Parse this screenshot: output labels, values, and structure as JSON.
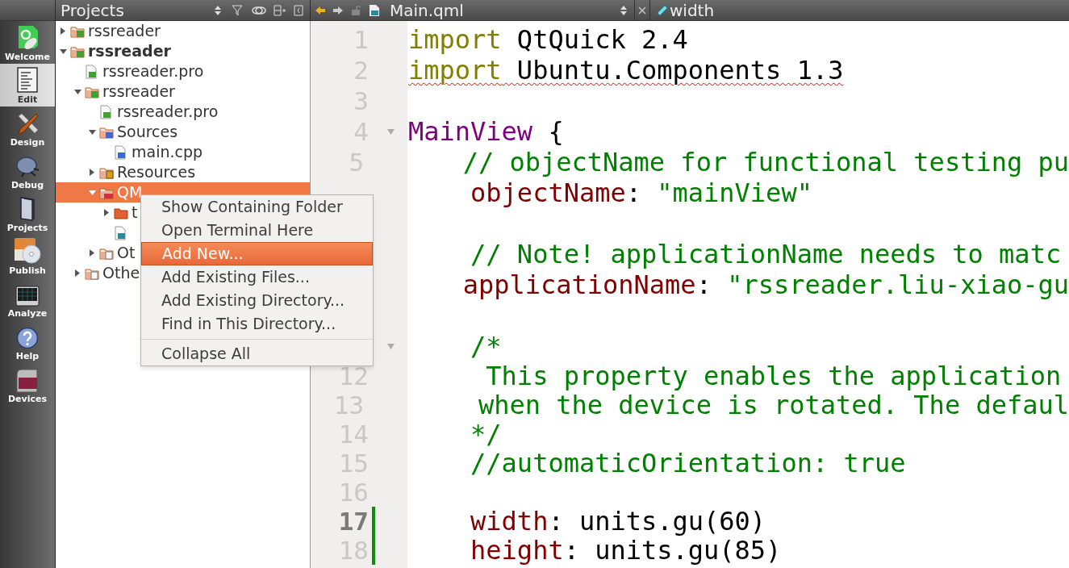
{
  "modes": [
    {
      "kind": "welcome",
      "label": "Welcome",
      "selected": false
    },
    {
      "kind": "edit",
      "label": "Edit",
      "selected": true
    },
    {
      "kind": "design",
      "label": "Design",
      "selected": false
    },
    {
      "kind": "debug",
      "label": "Debug",
      "selected": false
    },
    {
      "kind": "projects",
      "label": "Projects",
      "selected": false
    },
    {
      "kind": "publish",
      "label": "Publish",
      "selected": false
    },
    {
      "kind": "analyze",
      "label": "Analyze",
      "selected": false
    },
    {
      "kind": "help",
      "label": "Help",
      "selected": false
    },
    {
      "kind": "devices",
      "label": "Devices",
      "selected": false
    }
  ],
  "projects_panel": {
    "title": "Projects",
    "tree": [
      {
        "label": "rssreader",
        "kind": "project",
        "expanded": false,
        "active": false,
        "selected": false
      },
      {
        "label": "rssreader",
        "kind": "project",
        "expanded": true,
        "active": true,
        "selected": false,
        "children": [
          {
            "label": "rssreader.pro",
            "kind": "pro-file",
            "selected": false
          },
          {
            "label": "rssreader",
            "kind": "project",
            "expanded": true,
            "selected": false,
            "children": [
              {
                "label": "rssreader.pro",
                "kind": "pro-file",
                "selected": false
              },
              {
                "label": "Sources",
                "kind": "sources",
                "expanded": true,
                "selected": false,
                "children": [
                  {
                    "label": "main.cpp",
                    "kind": "cpp-file",
                    "selected": false
                  }
                ]
              },
              {
                "label": "Resources",
                "kind": "resources",
                "expanded": false,
                "selected": false
              },
              {
                "label": "QM",
                "kind": "qml-folder",
                "expanded": true,
                "selected": true,
                "children": [
                  {
                    "label": "t",
                    "kind": "folder",
                    "expanded": false,
                    "selected": false
                  },
                  {
                    "kind": "qml-file",
                    "selected": false
                  }
                ]
              },
              {
                "label": "Ot",
                "kind": "other",
                "expanded": false,
                "selected": false
              }
            ]
          },
          {
            "label": "Othe",
            "kind": "other",
            "expanded": false,
            "selected": false
          }
        ]
      }
    ]
  },
  "editor": {
    "file": "Main.qml",
    "symbol": "width",
    "lines": [
      {
        "number": "1",
        "tokens": [
          {
            "kind": "keyword",
            "text": "import"
          },
          {
            "kind": "plain",
            "text": " QtQuick 2.4"
          }
        ]
      },
      {
        "number": "2",
        "error": true,
        "tokens": [
          {
            "kind": "keyword",
            "text": "import"
          },
          {
            "kind": "plain",
            "text": " Ubuntu.Components 1.3"
          }
        ]
      },
      {
        "number": "3"
      },
      {
        "number": "4",
        "foldable": true,
        "tokens": [
          {
            "kind": "type",
            "text": "MainView"
          },
          {
            "kind": "plain",
            "text": " {"
          }
        ]
      },
      {
        "number": "5",
        "tokens": [
          {
            "kind": "comment",
            "text": "    // objectName for functional testing pu"
          }
        ]
      },
      {
        "tokens": [
          {
            "kind": "property",
            "text": "    objectName"
          },
          {
            "kind": "plain",
            "text": ": "
          },
          {
            "kind": "string",
            "text": "\"mainView\""
          }
        ]
      },
      {
        "changed": false
      },
      {
        "tokens": [
          {
            "kind": "comment",
            "text": "    // Note! applicationName needs to matc"
          }
        ]
      },
      {
        "tokens": [
          {
            "kind": "property",
            "text": "    applicationName"
          },
          {
            "kind": "plain",
            "text": ": "
          },
          {
            "kind": "string",
            "text": "\"rssreader.liu-xiao-gu"
          }
        ]
      },
      {
        "changed": false
      },
      {
        "foldable": true,
        "tokens": [
          {
            "kind": "comment",
            "text": "    /*"
          }
        ]
      },
      {
        "number": "12",
        "tokens": [
          {
            "kind": "comment",
            "text": "     This property enables the application"
          }
        ]
      },
      {
        "number": "13",
        "tokens": [
          {
            "kind": "comment",
            "text": "     when the device is rotated. The defaul"
          }
        ]
      },
      {
        "number": "14",
        "tokens": [
          {
            "kind": "comment",
            "text": "    */"
          }
        ]
      },
      {
        "number": "15",
        "tokens": [
          {
            "kind": "comment",
            "text": "    //automaticOrientation: true"
          }
        ]
      },
      {
        "number": "16"
      },
      {
        "number": "17",
        "current": true,
        "changed": true,
        "tokens": [
          {
            "kind": "property",
            "text": "    width"
          },
          {
            "kind": "plain",
            "text": ": units.gu(60)"
          }
        ]
      },
      {
        "number": "18",
        "changed": true,
        "tokens": [
          {
            "kind": "property",
            "text": "    height"
          },
          {
            "kind": "plain",
            "text": ": units.gu(85)"
          }
        ]
      }
    ]
  },
  "context_menu": [
    {
      "kind": "item",
      "label": "Show Containing Folder",
      "selected": false
    },
    {
      "kind": "item",
      "label": "Open Terminal Here",
      "selected": false
    },
    {
      "kind": "item",
      "label": "Add New...",
      "selected": true
    },
    {
      "kind": "item",
      "label": "Add Existing Files...",
      "selected": false
    },
    {
      "kind": "item",
      "label": "Add Existing Directory...",
      "selected": false
    },
    {
      "kind": "item",
      "label": "Find in This Directory...",
      "selected": false
    },
    {
      "kind": "separator"
    },
    {
      "kind": "item",
      "label": "Collapse All",
      "selected": false
    }
  ]
}
